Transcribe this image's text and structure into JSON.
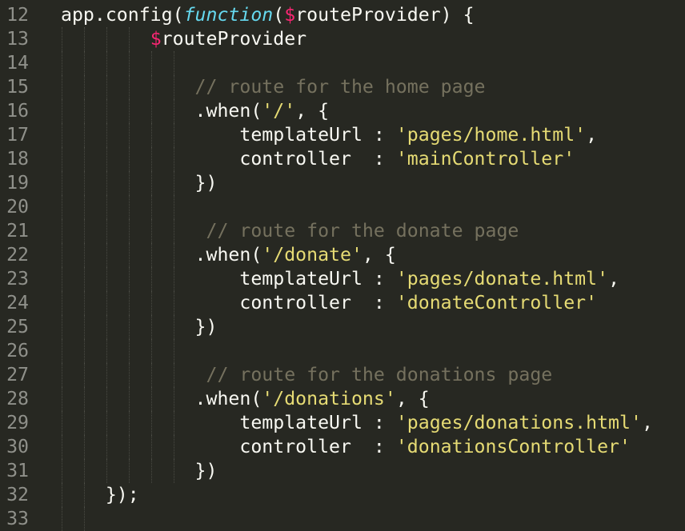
{
  "editor": {
    "theme_colors": {
      "background": "#272822",
      "text": "#f8f8f2",
      "comment": "#75715e",
      "string": "#e6db74",
      "keyword": "#66d9ef",
      "variable": "#f92672",
      "line_number": "#8f908a"
    },
    "lines": [
      {
        "number": "12",
        "tokens": [
          {
            "t": "plain",
            "v": "app.config("
          },
          {
            "t": "keyword",
            "v": "function"
          },
          {
            "t": "plain",
            "v": "("
          },
          {
            "t": "var",
            "v": "$"
          },
          {
            "t": "plain",
            "v": "routeProvider) {"
          }
        ]
      },
      {
        "number": "13",
        "tokens": [
          {
            "t": "plain",
            "v": "        "
          },
          {
            "t": "var",
            "v": "$"
          },
          {
            "t": "plain",
            "v": "routeProvider"
          }
        ]
      },
      {
        "number": "14",
        "tokens": []
      },
      {
        "number": "15",
        "tokens": [
          {
            "t": "plain",
            "v": "            "
          },
          {
            "t": "comment",
            "v": "// route for the home page"
          }
        ]
      },
      {
        "number": "16",
        "tokens": [
          {
            "t": "plain",
            "v": "            .when("
          },
          {
            "t": "string",
            "v": "'/'"
          },
          {
            "t": "plain",
            "v": ", {"
          }
        ]
      },
      {
        "number": "17",
        "tokens": [
          {
            "t": "plain",
            "v": "                templateUrl : "
          },
          {
            "t": "string",
            "v": "'pages/home.html'"
          },
          {
            "t": "plain",
            "v": ","
          }
        ]
      },
      {
        "number": "18",
        "tokens": [
          {
            "t": "plain",
            "v": "                controller  : "
          },
          {
            "t": "string",
            "v": "'mainController'"
          }
        ]
      },
      {
        "number": "19",
        "tokens": [
          {
            "t": "plain",
            "v": "            })"
          }
        ]
      },
      {
        "number": "20",
        "tokens": []
      },
      {
        "number": "21",
        "tokens": [
          {
            "t": "plain",
            "v": "             "
          },
          {
            "t": "comment",
            "v": "// route for the donate page"
          }
        ]
      },
      {
        "number": "22",
        "tokens": [
          {
            "t": "plain",
            "v": "            .when("
          },
          {
            "t": "string",
            "v": "'/donate'"
          },
          {
            "t": "plain",
            "v": ", {"
          }
        ]
      },
      {
        "number": "23",
        "tokens": [
          {
            "t": "plain",
            "v": "                templateUrl : "
          },
          {
            "t": "string",
            "v": "'pages/donate.html'"
          },
          {
            "t": "plain",
            "v": ","
          }
        ]
      },
      {
        "number": "24",
        "tokens": [
          {
            "t": "plain",
            "v": "                controller  : "
          },
          {
            "t": "string",
            "v": "'donateController'"
          }
        ]
      },
      {
        "number": "25",
        "tokens": [
          {
            "t": "plain",
            "v": "            })"
          }
        ]
      },
      {
        "number": "26",
        "tokens": []
      },
      {
        "number": "27",
        "tokens": [
          {
            "t": "plain",
            "v": "             "
          },
          {
            "t": "comment",
            "v": "// route for the donations page"
          }
        ]
      },
      {
        "number": "28",
        "tokens": [
          {
            "t": "plain",
            "v": "            .when("
          },
          {
            "t": "string",
            "v": "'/donations'"
          },
          {
            "t": "plain",
            "v": ", {"
          }
        ]
      },
      {
        "number": "29",
        "tokens": [
          {
            "t": "plain",
            "v": "                templateUrl : "
          },
          {
            "t": "string",
            "v": "'pages/donations.html'"
          },
          {
            "t": "plain",
            "v": ","
          }
        ]
      },
      {
        "number": "30",
        "tokens": [
          {
            "t": "plain",
            "v": "                controller  : "
          },
          {
            "t": "string",
            "v": "'donationsController'"
          }
        ]
      },
      {
        "number": "31",
        "tokens": [
          {
            "t": "plain",
            "v": "            })"
          }
        ]
      },
      {
        "number": "32",
        "tokens": [
          {
            "t": "plain",
            "v": "    });"
          }
        ]
      },
      {
        "number": "33",
        "tokens": []
      }
    ]
  }
}
